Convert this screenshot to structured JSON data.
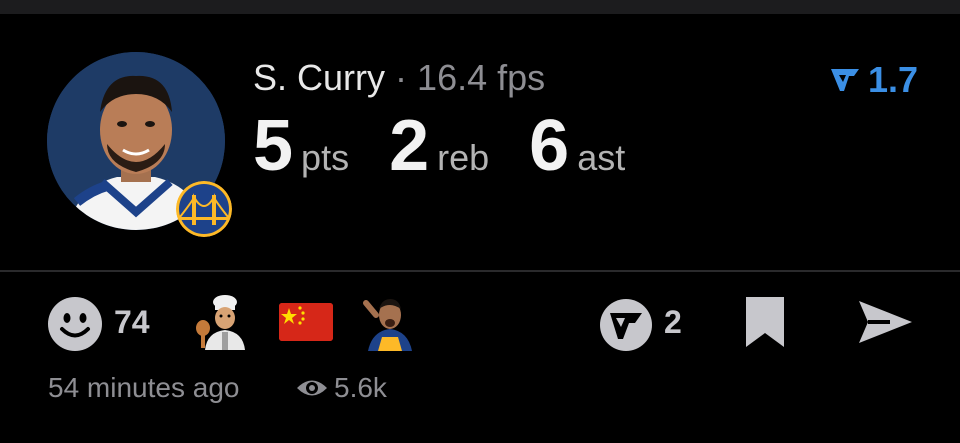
{
  "post": {
    "player_name": "S. Curry",
    "separator": "·",
    "fps": "16.4 fps",
    "score": "1.7",
    "stats": [
      {
        "value": "5",
        "label": "pts"
      },
      {
        "value": "2",
        "label": "reb"
      },
      {
        "value": "6",
        "label": "ast"
      }
    ]
  },
  "reactions": {
    "smile_count": "74",
    "emojis": [
      "smile-icon",
      "chef-icon",
      "china-flag-icon",
      "player-reaction-icon"
    ]
  },
  "actions": {
    "vote_count": "2"
  },
  "meta": {
    "time_ago": "54 minutes ago",
    "views": "5.6k"
  },
  "colors": {
    "accent": "#3b8fe5",
    "background": "#000000",
    "muted": "#8e8e93"
  }
}
